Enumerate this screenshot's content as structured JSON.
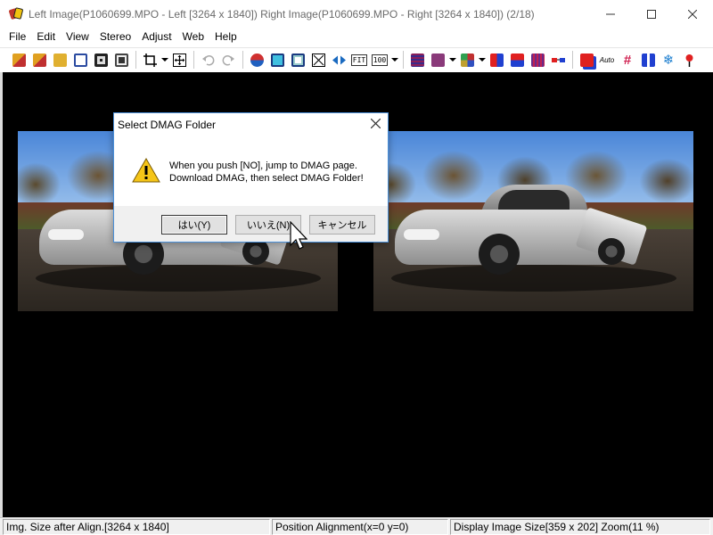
{
  "window": {
    "title": "Left Image(P1060699.MPO - Left [3264 x 1840]) Right Image(P1060699.MPO - Right [3264 x 1840])  (2/18)",
    "minimize_icon": "minimize-icon",
    "maximize_icon": "maximize-icon",
    "close_icon": "close-icon"
  },
  "menu": [
    "File",
    "Edit",
    "View",
    "Stereo",
    "Adjust",
    "Web",
    "Help"
  ],
  "toolbar": {
    "fit_label": "FIT",
    "zoom100_label": "100",
    "auto_label": "Auto"
  },
  "dialog": {
    "title": "Select DMAG Folder",
    "line1": "When you push [NO], jump to DMAG page.",
    "line2": "Download DMAG, then select DMAG Folder!",
    "yes": "はい(Y)",
    "no": "いいえ(N)",
    "cancel": "キャンセル",
    "icon": "warning-icon"
  },
  "status": {
    "size": "Img. Size after Align.[3264 x 1840]",
    "position": "Position Alignment(x=0 y=0)",
    "display": "Display Image Size[359 x 202]  Zoom(11 %)"
  },
  "colors": {
    "background": "#000000",
    "dialog_border": "#4a90d9"
  }
}
